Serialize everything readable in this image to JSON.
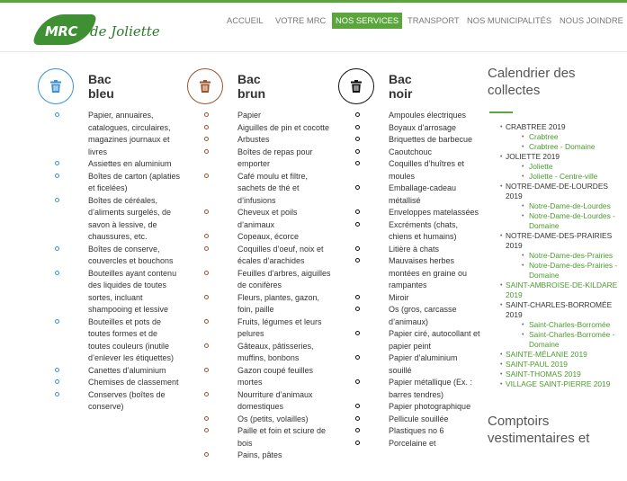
{
  "header": {
    "logo_mrc": "MRC",
    "logo_name": "de Joliette",
    "nav": [
      {
        "label": "ACCUEIL",
        "active": false
      },
      {
        "label": "VOTRE MRC",
        "active": false
      },
      {
        "label": "NOS SERVICES",
        "active": true
      },
      {
        "label": "TRANSPORT",
        "active": false
      },
      {
        "label": "NOS MUNICIPALITÉS",
        "active": false
      },
      {
        "label": "NOUS JOINDRE",
        "active": false
      }
    ]
  },
  "colors": {
    "green": "#5aa63c",
    "bleu": "#3a8fd6",
    "brun": "#a0522d",
    "noir": "#111111"
  },
  "bins": [
    {
      "icon": "trash-icon",
      "title_line1": "Bac",
      "title_line2": "bleu",
      "items": [
        "Papier, annuaires, catalogues, circulaires, magazines journaux et livres",
        "Assiettes en aluminium",
        "Boîtes de carton (aplaties et ficelées)",
        "Boîtes de céréales, d’aliments surgelés, de savon à lessive, de chaussures, etc.",
        "Boîtes de conserve, couvercles et bouchons",
        "Bouteilles ayant contenu des liquides de toutes sortes, incluant shampooing et lessive",
        "Bouteilles et pots de toutes formes et de toutes couleurs (inutile d’enlever les étiquettes)",
        "Canettes d’aluminium",
        "Chemises de classement",
        "Conserves (boîtes de conserve)"
      ]
    },
    {
      "icon": "trash-icon",
      "title_line1": "Bac",
      "title_line2": "brun",
      "items": [
        "Papier",
        "Aiguilles de pin et cocotte",
        "Arbustes",
        "Boîtes de repas pour emporter",
        "Café moulu et filtre, sachets de thé et d’infusions",
        "Cheveux et poils d’animaux",
        "Copeaux, écorce",
        "Coquilles d’oeuf, noix et écales d’arachides",
        "Feuilles d’arbres, aiguilles de conifères",
        "Fleurs, plantes, gazon, foin, paille",
        "Fruits, légumes et leurs pelures",
        "Gâteaux, pâtisseries, muffins, bonbons",
        "Gazon coupé feuilles mortes",
        "Nourriture d’animaux domestiques",
        "Os (petits, volailles)",
        "Paille et foin et sciure de bois",
        "Pains, pâtes"
      ]
    },
    {
      "icon": "trash-icon",
      "title_line1": "Bac",
      "title_line2": "noir",
      "items": [
        "Ampoules électriques",
        "Boyaux d’arrosage",
        "Briquettes de barbecue",
        "Caoutchouc",
        "Coquilles d’huîtres et moules",
        "Emballage-cadeau métallisé",
        "Enveloppes matelassées",
        "Excréments (chats, chiens et humains)",
        "Litière à chats",
        "Mauvaises herbes montées en graine ou rampantes",
        "Miroir",
        "Os (gros, carcasse d’animaux)",
        "Papier ciré, autocollant et papier peint",
        "Papier d’aluminium souillé",
        "Papier métallique (Ex. : barres tendres)",
        "Papier photographique",
        "Pellicule souillée",
        "Plastiques no 6",
        "Porcelaine et"
      ]
    }
  ],
  "sidebar": {
    "title": "Calendrier des collectes",
    "tree": [
      {
        "label": "CRABTREE 2019",
        "link": false,
        "children": [
          "Crabtree",
          "Crabtree - Domaine"
        ]
      },
      {
        "label": "JOLIETTE 2019",
        "link": false,
        "children": [
          "Joliette",
          "Joliette - Centre-ville"
        ]
      },
      {
        "label": "NOTRE-DAME-DE-LOURDES 2019",
        "link": false,
        "children": [
          "Notre-Dame-de-Lourdes",
          "Notre-Dame-de-Lourdes - Domaine"
        ]
      },
      {
        "label": "NOTRE-DAME-DES-PRAIRIES 2019",
        "link": false,
        "children": [
          "Notre-Dame-des-Prairies",
          "Notre-Dame-des-Prairies - Domaine"
        ]
      },
      {
        "label": "SAINT-AMBROISE-DE-KILDARE 2019",
        "link": true,
        "children": []
      },
      {
        "label": "SAINT-CHARLES-BORROMÉE 2019",
        "link": false,
        "children": [
          "Saint-Charles-Borromée",
          "Saint-Charles-Borromée - Domaine"
        ]
      },
      {
        "label": "SAINTE-MÉLANIE 2019",
        "link": true,
        "children": []
      },
      {
        "label": "SAINT-PAUL 2019",
        "link": true,
        "children": []
      },
      {
        "label": "SAINT-THOMAS 2019",
        "link": true,
        "children": []
      },
      {
        "label": "VILLAGE SAINT-PIERRE 2019",
        "link": true,
        "children": []
      }
    ],
    "second_title": "Comptoirs vestimentaires et"
  }
}
